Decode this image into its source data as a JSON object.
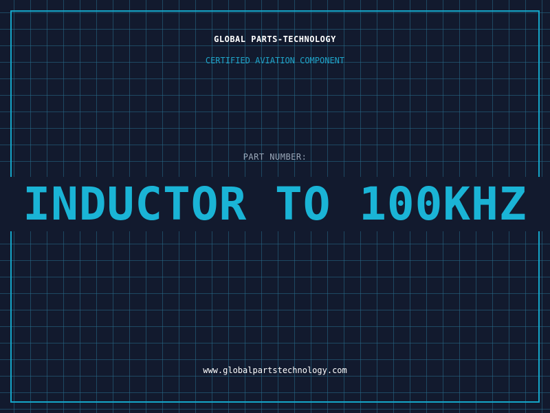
{
  "header": {
    "company": "GLOBAL PARTS-TECHNOLOGY",
    "tagline": "CERTIFIED AVIATION COMPONENT"
  },
  "part": {
    "label": "PART NUMBER:",
    "number": "INDUCTOR TO 100KHZ"
  },
  "footer": {
    "website": "www.globalpartstechnology.com"
  },
  "colors": {
    "background": "#121a2e",
    "accent": "#1ab4d6",
    "grid": "#286e8c",
    "label": "#9aa7b8",
    "text": "#ffffff"
  }
}
